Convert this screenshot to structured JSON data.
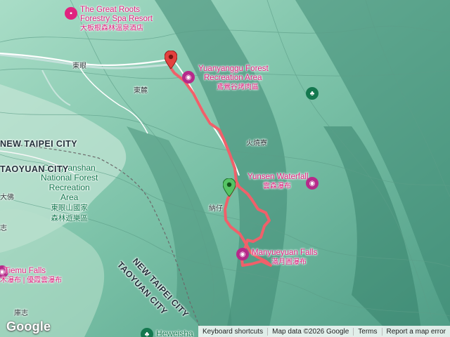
{
  "map": {
    "pois": [
      {
        "name": "The Great Roots Forestry Spa Resort",
        "line1": "The Great Roots",
        "line2": "Forestry Spa Resort",
        "local": "大板根森林溫泉酒店",
        "color": "#e0237f",
        "icon": "hotel-icon"
      },
      {
        "name": "Yuanyanggu Forest Recreation Area",
        "line1": "Yuanyanggu Forest",
        "line2": "Recreation Area",
        "local": "鳶鶯谷烤肉區",
        "color": "#e0237f",
        "icon": "camera-icon"
      },
      {
        "name": "Yunsen Waterfall",
        "line1": "Yunsen Waterfall",
        "local": "雲森瀑布",
        "color": "#e0237f",
        "icon": "camera-icon"
      },
      {
        "name": "Manyueyuan Falls",
        "line1": "Manyueyuan Falls",
        "local": "滿月圓瀑布",
        "color": "#e0237f",
        "icon": "camera-icon"
      },
      {
        "name": "Dongyanshan National Forest Recreation Area",
        "line1": "Dongyanshan",
        "line2": "National Forest",
        "line3": "Recreation",
        "line4": "Area",
        "local1": "東眼山國家",
        "local2": "森林遊樂區",
        "color": "#14784f",
        "icon": "park-icon"
      },
      {
        "name": "Tiemu Falls",
        "line1": "Tiemu Falls",
        "local": "木瀑布 | 優霞雲瀑布",
        "color": "#e0237f",
        "icon": "camera-icon"
      },
      {
        "name": "Heweisha",
        "line1": "Heweisha",
        "color": "#14784f",
        "icon": "park-icon"
      }
    ],
    "areas": [
      "NEW TAIPEI CITY",
      "TAOYUAN CITY",
      "NEW TAIPEI CITY",
      "TAOYUAN CITY"
    ],
    "places": [
      "東眼",
      "東麓",
      "火燒寮",
      "納仔",
      "庫志",
      "志",
      "大佛"
    ],
    "route": {
      "start": "start-marker",
      "end": "end-marker",
      "color": "#f0606a"
    }
  },
  "branding": {
    "logo": "Google"
  },
  "attribution": {
    "shortcuts": "Keyboard shortcuts",
    "mapdata": "Map data ©2026 Google",
    "terms": "Terms",
    "report": "Report a map error"
  }
}
